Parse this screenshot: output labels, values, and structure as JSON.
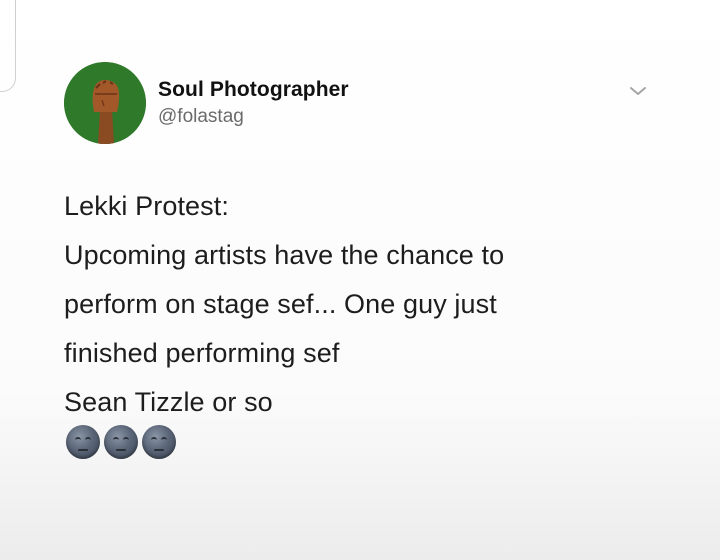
{
  "tweet": {
    "author": {
      "display_name": "Soul Photographer",
      "handle": "@folastag",
      "avatar_icon": "raised-fist-icon",
      "avatar_color": "#2f7a2a"
    },
    "menu_icon": "chevron-down-icon",
    "text_lines": [
      "Lekki Protest:",
      "Upcoming artists have the chance to",
      "perform on stage sef... One guy just",
      "finished performing sef",
      "Sean Tizzle or so"
    ],
    "emojis": [
      "face-exhaling-emoji",
      "face-exhaling-emoji",
      "face-exhaling-emoji"
    ]
  }
}
